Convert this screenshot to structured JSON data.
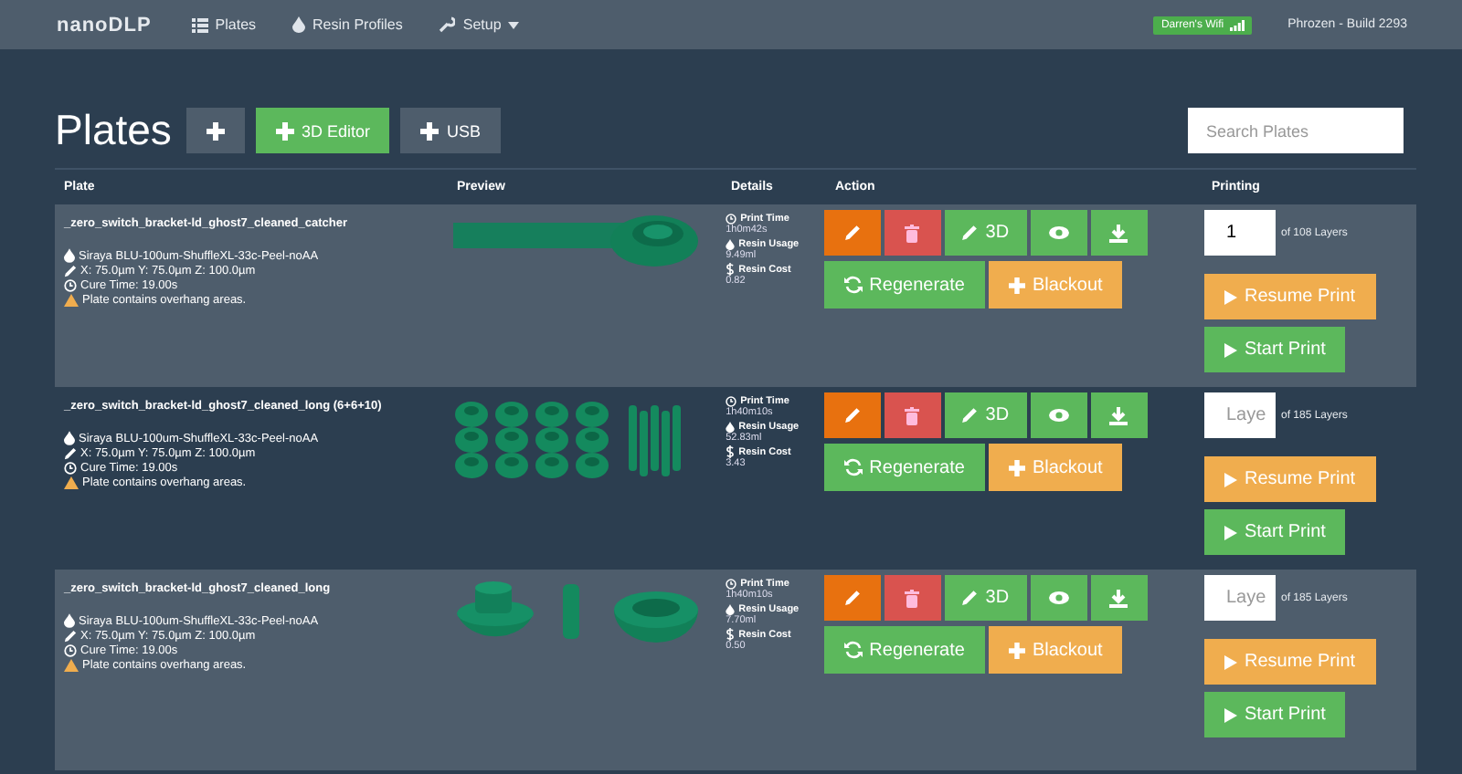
{
  "navbar": {
    "logo": "nanoDLP",
    "items": [
      {
        "label": "Plates",
        "kind": "list",
        "dropdown": false
      },
      {
        "label": "Resin Profiles",
        "kind": "drop",
        "dropdown": false
      },
      {
        "label": "Setup",
        "kind": "wrench",
        "dropdown": true
      }
    ],
    "wifi": "Darren's Wifi",
    "build": "Phrozen - Build 2293"
  },
  "page": {
    "title": "Plates",
    "buttons": [
      {
        "kind": "add"
      },
      {
        "kind": "editor",
        "label": "3D Editor"
      },
      {
        "kind": "usb",
        "label": "USB"
      }
    ],
    "search": {
      "placeholder": "Search Plates"
    }
  },
  "table": {
    "columns": [
      "Plate",
      "Preview",
      "Details",
      "Action",
      "Printing"
    ],
    "rows": [
      {
        "name": "_zero_switch_bracket-ld_ghost7_cleaned_catcher",
        "profile": "Siraya BLU-100um-ShuffleXL-33c-Peel-noAA",
        "resolution": "X: 75.0µm Y: 75.0µm Z: 100.0µm",
        "cure_time": "Cure Time: 19.00s",
        "warning": "Plate contains overhang areas.",
        "preview": {
          "kind": "bar-ring"
        },
        "print_time_label": "Print Time",
        "print_time": "1h0m42s",
        "resin_usage_label": "Resin Usage",
        "resin_usage": "9.49ml",
        "resin_cost_label": "Resin Cost",
        "resin_cost": "0.82",
        "edit3d": "3D",
        "regenerate": "Regenerate",
        "blackout": "Blackout",
        "layer": {
          "value": "1"
        },
        "layers": "of 108 Layers",
        "resume": "Resume Print",
        "start": "Start Print"
      },
      {
        "name": "_zero_switch_bracket-ld_ghost7_cleaned_long (6+6+10)",
        "profile": "Siraya BLU-100um-ShuffleXL-33c-Peel-noAA",
        "resolution": "X: 75.0µm Y: 75.0µm Z: 100.0µm",
        "cure_time": "Cure Time: 19.00s",
        "warning": "Plate contains overhang areas.",
        "preview": {
          "kind": "grid"
        },
        "print_time_label": "Print Time",
        "print_time": "1h40m10s",
        "resin_usage_label": "Resin Usage",
        "resin_usage": "52.83ml",
        "resin_cost_label": "Resin Cost",
        "resin_cost": "3.43",
        "edit3d": "3D",
        "regenerate": "Regenerate",
        "blackout": "Blackout",
        "layer": {
          "placeholder": "Laye"
        },
        "layers": "of 185 Layers",
        "resume": "Resume Print",
        "start": "Start Print"
      },
      {
        "name": "_zero_switch_bracket-ld_ghost7_cleaned_long",
        "profile": "Siraya BLU-100um-ShuffleXL-33c-Peel-noAA",
        "resolution": "X: 75.0µm Y: 75.0µm Z: 100.0µm",
        "cure_time": "Cure Time: 19.00s",
        "warning": "Plate contains overhang areas.",
        "preview": {
          "kind": "three-parts"
        },
        "print_time_label": "Print Time",
        "print_time": "1h40m10s",
        "resin_usage_label": "Resin Usage",
        "resin_usage": "7.70ml",
        "resin_cost_label": "Resin Cost",
        "resin_cost": "0.50",
        "edit3d": "3D",
        "regenerate": "Regenerate",
        "blackout": "Blackout",
        "layer": {
          "placeholder": "Laye"
        },
        "layers": "of 185 Layers",
        "resume": "Resume Print",
        "start": "Start Print"
      }
    ]
  }
}
